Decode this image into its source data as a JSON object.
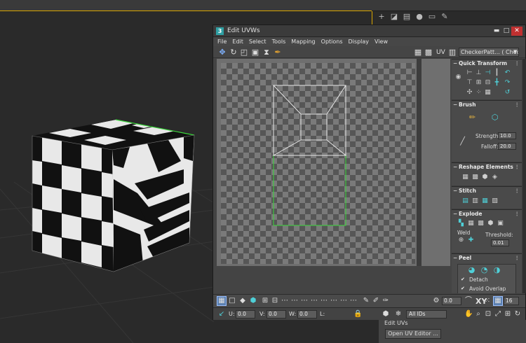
{
  "window": {
    "title": "Edit UVWs",
    "app_icon_glyph": "3",
    "minimize_glyph": "▬",
    "maximize_glyph": "□",
    "close_glyph": "✕"
  },
  "menu": [
    "File",
    "Edit",
    "Select",
    "Tools",
    "Mapping",
    "Options",
    "Display",
    "View"
  ],
  "toolbar": {
    "uv_label": "UV",
    "texture_selector": "CheckerPatt... ( Checker )"
  },
  "panel": {
    "quick_transform": {
      "title": "Quick Transform"
    },
    "brush": {
      "title": "Brush",
      "strength_label": "Strength:",
      "strength_value": "10.0",
      "falloff_label": "Falloff:",
      "falloff_value": "20.0"
    },
    "reshape": {
      "title": "Reshape Elements"
    },
    "stitch": {
      "title": "Stitch"
    },
    "explode": {
      "title": "Explode",
      "weld_label": "Weld",
      "threshold_label": "Threshold:",
      "threshold_value": "0.01"
    },
    "peel": {
      "title": "Peel",
      "detach_label": "Detach",
      "avoid_overlap_label": "Avoid Overlap"
    }
  },
  "bottom": {
    "u_label": "U:",
    "u_value": "0.0",
    "v_label": "V:",
    "v_value": "0.0",
    "w_label": "W:",
    "w_value": "0.0",
    "l_label": "L:",
    "rotation_value": "0.0",
    "xy_label": "XY",
    "grid_value": "16",
    "ids_selector": "All IDs"
  },
  "modifier_stub": {
    "label": "Edit UVs",
    "button": "Open UV Editor ..."
  },
  "colors": {
    "uv_border": "#3bd63b",
    "uv_edges": "#e6e6e6",
    "accent": "#4fd0d8",
    "close": "#c03030"
  }
}
